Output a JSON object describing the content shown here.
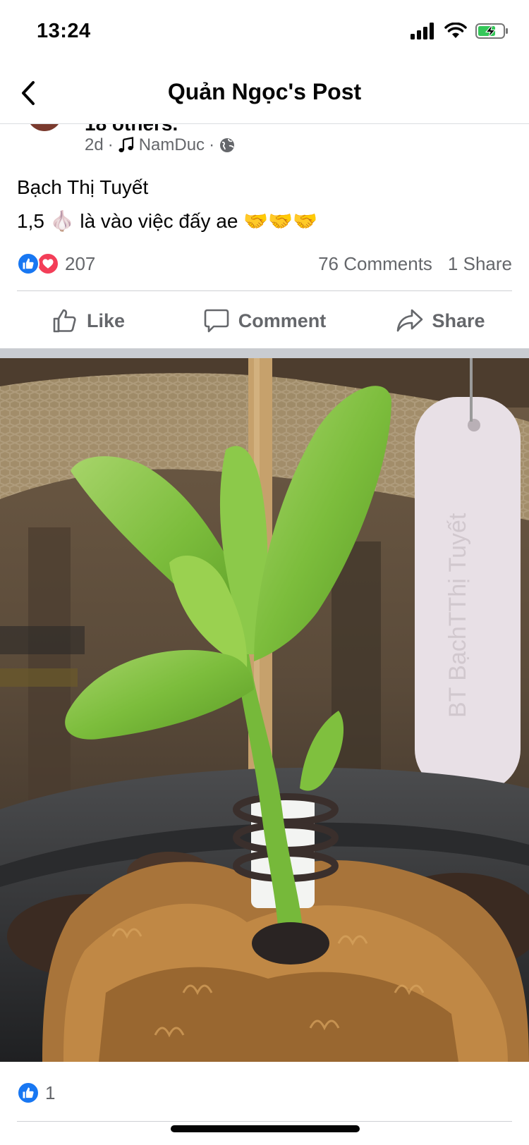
{
  "status_bar": {
    "time": "13:24"
  },
  "nav": {
    "title": "Quản Ngọc's Post"
  },
  "post": {
    "author_peek": "18 others.",
    "time_ago": "2d",
    "music_artist": "NamDuc",
    "lines": [
      "Bạch Thị Tuyết",
      "1,5 🧄 là vào việc đấy ae 🤝🤝🤝"
    ],
    "reaction_count": "207",
    "comments_label": "76 Comments",
    "shares_label": "1 Share"
  },
  "actions": {
    "like": "Like",
    "comment": "Comment",
    "share": "Share"
  },
  "photo": {
    "tag_text": "BT BạchTThị Tuyết"
  },
  "photo_reactions": {
    "count": "1"
  },
  "colors": {
    "facebook_blue": "#1877f2",
    "love_red": "#f33e58",
    "meta_gray": "#65676b"
  }
}
